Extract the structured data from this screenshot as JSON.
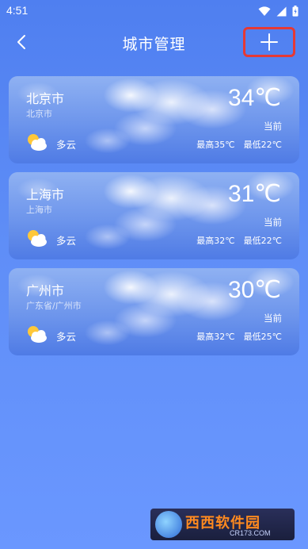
{
  "status_bar": {
    "time": "4:51"
  },
  "header": {
    "title": "城市管理"
  },
  "cities": [
    {
      "name": "北京市",
      "region": "北京市",
      "temp": "34℃",
      "current_label": "当前",
      "weather": "多云",
      "high": "最高35℃",
      "low": "最低22℃"
    },
    {
      "name": "上海市",
      "region": "上海市",
      "temp": "31℃",
      "current_label": "当前",
      "weather": "多云",
      "high": "最高32℃",
      "low": "最低22℃"
    },
    {
      "name": "广州市",
      "region": "广东省/广州市",
      "temp": "30℃",
      "current_label": "当前",
      "weather": "多云",
      "high": "最高32℃",
      "low": "最低25℃"
    }
  ],
  "watermark": {
    "text": "西西软件园",
    "url": "CR173.COM"
  },
  "colors": {
    "highlight_border": "#e53935",
    "background_top": "#4f7ff0",
    "background_bottom": "#6a97ff"
  },
  "icons": [
    "wifi-icon",
    "signal-icon",
    "battery-icon",
    "back-arrow-icon",
    "plus-icon",
    "partly-cloudy-icon"
  ]
}
